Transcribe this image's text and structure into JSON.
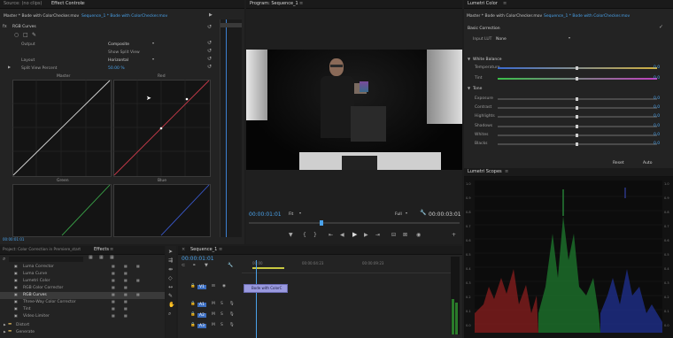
{
  "effect_controls": {
    "tabs": [
      "Source: (no clips)",
      "Effect Controls",
      "≡"
    ],
    "active_tab": "Effect Controls",
    "breadcrumb_master": "Master * Bode with ColorChecker.mov",
    "breadcrumb_sequence": "Sequence_1 * Bode with ColorChecker.mov",
    "fx_name": "RGB Curves",
    "output_label": "Output",
    "output_value": "Composite",
    "show_split_label": "Show Split View",
    "layout_label": "Layout",
    "layout_value": "Horizontal",
    "split_percent_label": "Split View Percent",
    "split_percent_value": "50.00 %",
    "curve_labels": [
      "Master",
      "Red",
      "Green",
      "Blue"
    ],
    "timecode": "00:00:01:01"
  },
  "program_monitor": {
    "title": "Program: Sequence_1",
    "timecode_left": "00:00:01:01",
    "fit_value": "Fit",
    "quality_value": "Full",
    "timecode_right": "00:00:03:01"
  },
  "lumetri_color": {
    "tab": "Lumetri Color",
    "breadcrumb_master": "Master * Bode with ColorChecker.mov",
    "breadcrumb_sequence": "Sequence_1 * Bode with ColorChecker.mov",
    "basic_correction": "Basic Correction",
    "input_lut_label": "Input LUT",
    "input_lut_value": "None",
    "white_balance": "White Balance",
    "tone": "Tone",
    "sliders": [
      {
        "label": "Temperature",
        "value": "0.0",
        "level": 0.5,
        "color": "#c08a3a"
      },
      {
        "label": "Tint",
        "value": "0.0",
        "level": 0.5,
        "color": "#b04ab0"
      },
      {
        "label": "Exposure",
        "value": "0.0",
        "level": 0.5,
        "color": "#555"
      },
      {
        "label": "Contrast",
        "value": "0.0",
        "level": 0.5,
        "color": "#555"
      },
      {
        "label": "Highlights",
        "value": "0.0",
        "level": 0.5,
        "color": "#555"
      },
      {
        "label": "Shadows",
        "value": "0.0",
        "level": 0.5,
        "color": "#555"
      },
      {
        "label": "Whites",
        "value": "0.0",
        "level": 0.5,
        "color": "#555"
      },
      {
        "label": "Blacks",
        "value": "0.0",
        "level": 0.5,
        "color": "#555"
      }
    ],
    "reset_label": "Reset",
    "auto_label": "Auto"
  },
  "lumetri_scopes": {
    "tab": "Lumetri Scopes",
    "ticks_left": [
      "1.0",
      "0.9",
      "0.8",
      "0.7",
      "0.6",
      "0.5",
      "0.4",
      "0.3",
      "0.2",
      "0.1",
      "0.0"
    ],
    "ticks_right": [
      "1.0",
      "0.9",
      "0.8",
      "0.7",
      "0.6",
      "0.5",
      "0.4",
      "0.3",
      "0.2",
      "0.1",
      "0.0"
    ]
  },
  "effects_panel": {
    "tabs": [
      "Project: Color Correction in Premiere_start",
      "Effects",
      "≡"
    ],
    "active_tab": "Effects",
    "items": [
      "Luma Corrector",
      "Luma Curve",
      "Lumetri Color",
      "RGB Color Corrector",
      "RGB Curves",
      "Three-Way Color Corrector",
      "Tint",
      "Video Limiter"
    ],
    "selected_item": "RGB Curves",
    "folders": [
      "Distort",
      "Generate"
    ]
  },
  "timeline": {
    "tab": "Sequence_1",
    "timecode": "00:00:01:01",
    "ruler": [
      "00:00",
      "00:00:04:23",
      "00:00:09:23"
    ],
    "tracks": [
      "V1",
      "A1",
      "A2",
      "A3"
    ],
    "clip_label": "Bode with ColorC"
  }
}
